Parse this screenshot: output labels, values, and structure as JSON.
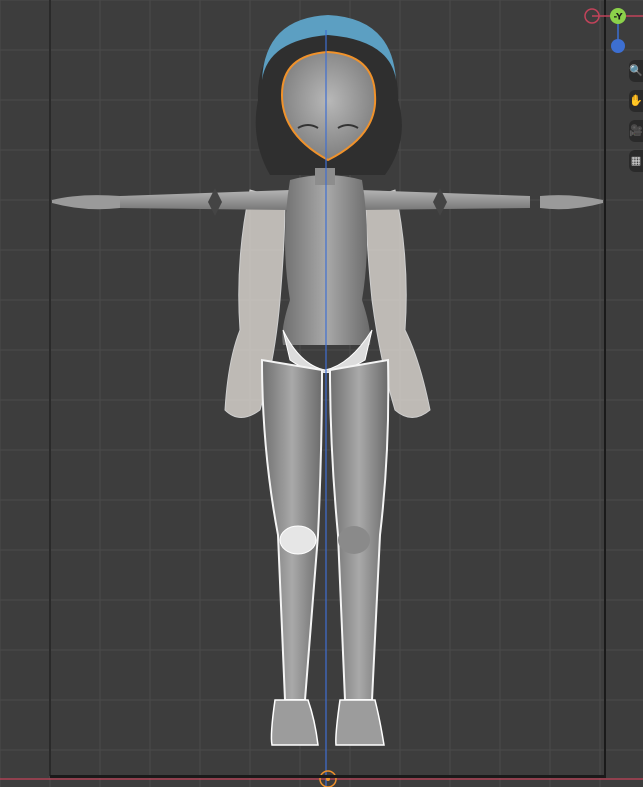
{
  "viewport": {
    "background": "#3d3d3d",
    "grid_color": "#4a4a4a",
    "grid_major_color": "#545454",
    "axis_y_color": "#3f6fd1",
    "axis_x_color": "#c2435a",
    "selection_color": "#f0922b",
    "active_color": "#5c9fc2"
  },
  "gizmo": {
    "y_label": "-Y",
    "y_color": "#8bd14a",
    "x_color": "#c2435a",
    "z_color": "#3d6fd1"
  },
  "tools": [
    {
      "name": "zoom-icon",
      "glyph": "🔍"
    },
    {
      "name": "hand-icon",
      "glyph": "✋"
    },
    {
      "name": "camera-icon",
      "glyph": "🎥"
    },
    {
      "name": "grid-icon",
      "glyph": "▦"
    }
  ]
}
